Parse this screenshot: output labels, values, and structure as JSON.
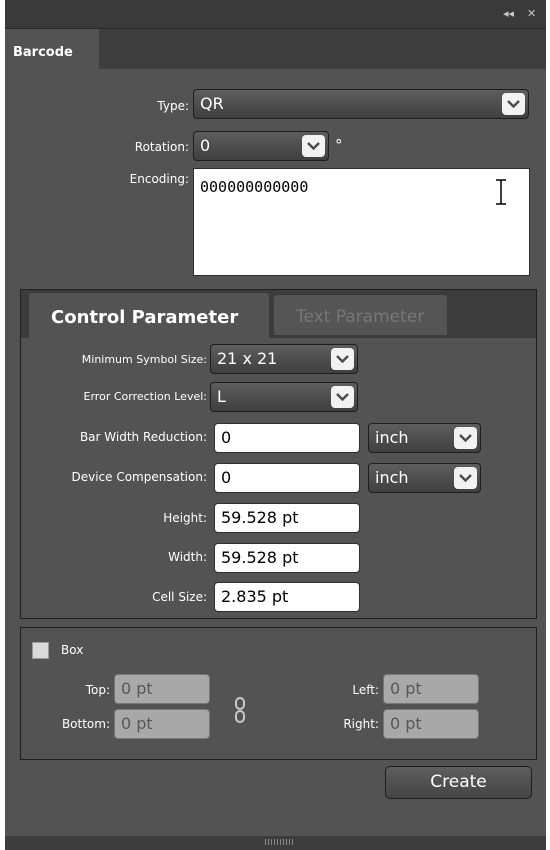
{
  "panel": {
    "tab_label": "Barcode",
    "collapse_glyph": "◂◂",
    "close_glyph": "✕"
  },
  "main": {
    "type_label": "Type:",
    "type_value": "QR",
    "rotation_label": "Rotation:",
    "rotation_value": "0",
    "rotation_unit": "°",
    "encoding_label": "Encoding:",
    "encoding_value": "000000000000"
  },
  "tabs": {
    "control": "Control Parameter",
    "text": "Text Parameter"
  },
  "control": {
    "min_symbol_label": "Minimum Symbol Size:",
    "min_symbol_value": "21 x 21",
    "ecl_label": "Error Correction Level:",
    "ecl_value": "L",
    "bwr_label": "Bar Width Reduction:",
    "bwr_value": "0",
    "bwr_unit": "inch",
    "dc_label": "Device Compensation:",
    "dc_value": "0",
    "dc_unit": "inch",
    "height_label": "Height:",
    "height_value": "59.528 pt",
    "width_label": "Width:",
    "width_value": "59.528 pt",
    "cell_label": "Cell Size:",
    "cell_value": "2.835 pt"
  },
  "box": {
    "label": "Box",
    "checked": false,
    "top_label": "Top:",
    "top_value": "0 pt",
    "bottom_label": "Bottom:",
    "bottom_value": "0 pt",
    "left_label": "Left:",
    "left_value": "0 pt",
    "right_label": "Right:",
    "right_value": "0 pt"
  },
  "actions": {
    "create_label": "Create"
  }
}
